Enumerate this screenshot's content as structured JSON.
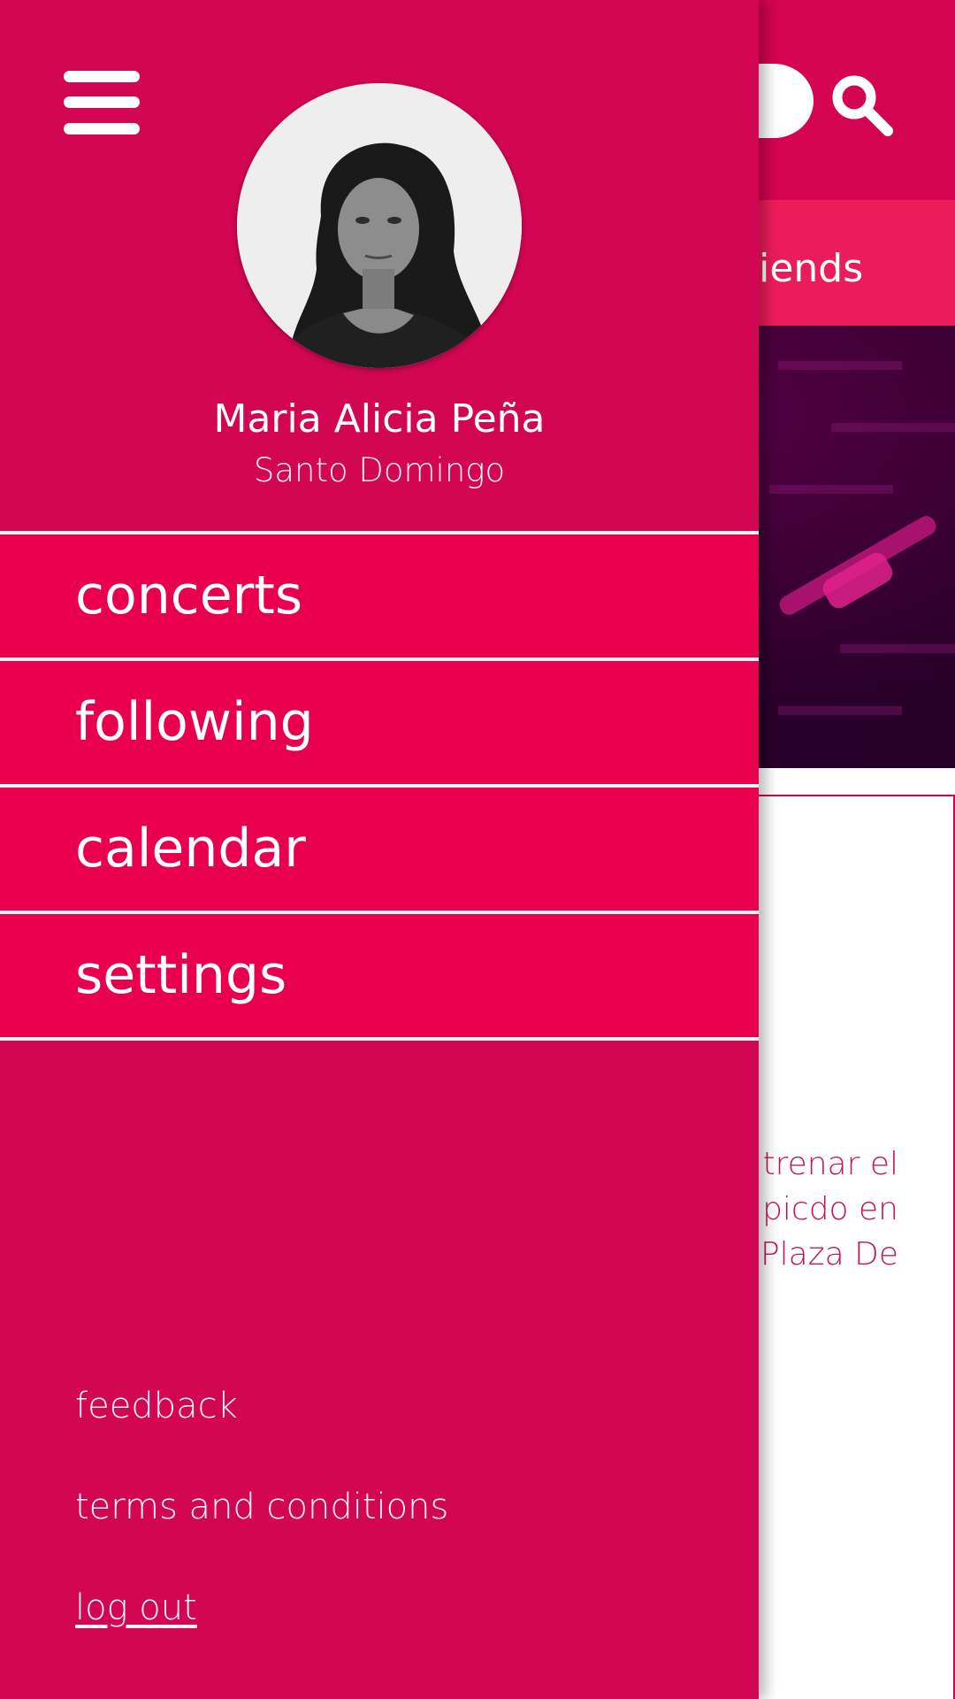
{
  "background": {
    "tab_label": "riends",
    "description_lines": [
      "trenar el",
      "picdo en",
      "Plaza De"
    ]
  },
  "drawer": {
    "profile": {
      "name": "Maria Alicia Peña",
      "city": "Santo Domingo"
    },
    "menu": [
      {
        "label": "concerts"
      },
      {
        "label": "following"
      },
      {
        "label": "calendar"
      },
      {
        "label": "settings"
      }
    ],
    "footer": {
      "feedback": "feedback",
      "terms": "terms and conditions",
      "logout": "log out"
    }
  },
  "icons": {
    "menu": "hamburger-icon",
    "search": "search-icon"
  },
  "colors": {
    "drawer_bg": "#d20653",
    "menu_item_bg": "#e8004e",
    "topbar": "#d40452",
    "tabbar": "#ec1c5a",
    "divider": "#f2f2f2",
    "text": "#ffffff"
  }
}
